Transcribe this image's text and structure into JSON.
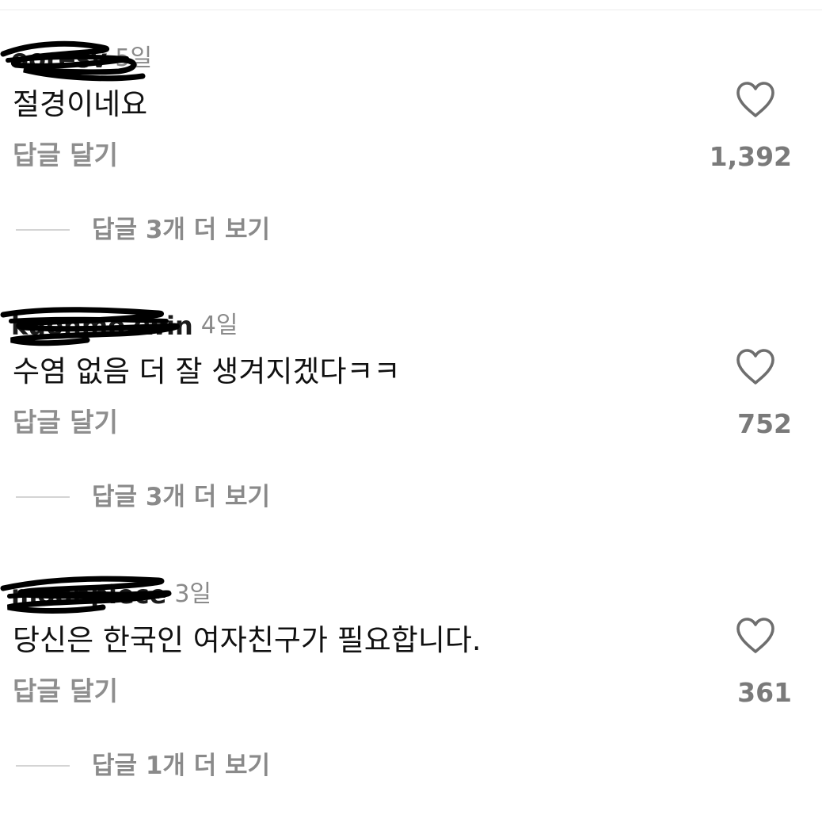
{
  "colors": {
    "text_primary": "#111111",
    "text_secondary": "#8a8a8a",
    "like_count": "#7a7a7a",
    "divider": "#d4d4d4",
    "redaction": "#000000"
  },
  "comments": [
    {
      "username": "ooresv",
      "time": "5일",
      "text": "절경이네요",
      "reply_label": "답글 달기",
      "like_icon": "heart-outline-icon",
      "likes": "1,392",
      "view_replies": "답글 3개 더 보기"
    },
    {
      "username": "kuonmo2win",
      "time": "4일",
      "text": "수염 없음 더 잘 생겨지겠다ㅋㅋ",
      "reply_label": "답글 달기",
      "like_icon": "heart-outline-icon",
      "likes": "752",
      "view_replies": "답글 3개 더 보기"
    },
    {
      "username": "moonpiece",
      "time": "3일",
      "text": "당신은 한국인 여자친구가 필요합니다.",
      "reply_label": "답글 달기",
      "like_icon": "heart-outline-icon",
      "likes": "361",
      "view_replies": "답글 1개 더 보기"
    }
  ]
}
